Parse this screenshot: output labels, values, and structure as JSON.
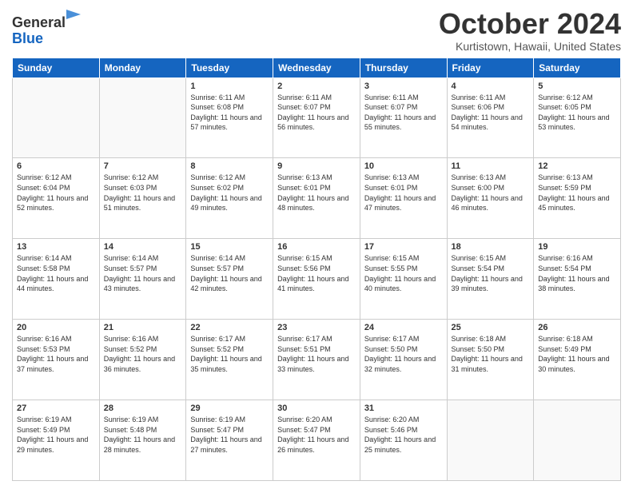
{
  "header": {
    "logo_general": "General",
    "logo_blue": "Blue",
    "month_title": "October 2024",
    "location": "Kurtistown, Hawaii, United States"
  },
  "days_of_week": [
    "Sunday",
    "Monday",
    "Tuesday",
    "Wednesday",
    "Thursday",
    "Friday",
    "Saturday"
  ],
  "weeks": [
    [
      {
        "day": "",
        "sunrise": "",
        "sunset": "",
        "daylight": ""
      },
      {
        "day": "",
        "sunrise": "",
        "sunset": "",
        "daylight": ""
      },
      {
        "day": "1",
        "sunrise": "Sunrise: 6:11 AM",
        "sunset": "Sunset: 6:08 PM",
        "daylight": "Daylight: 11 hours and 57 minutes."
      },
      {
        "day": "2",
        "sunrise": "Sunrise: 6:11 AM",
        "sunset": "Sunset: 6:07 PM",
        "daylight": "Daylight: 11 hours and 56 minutes."
      },
      {
        "day": "3",
        "sunrise": "Sunrise: 6:11 AM",
        "sunset": "Sunset: 6:07 PM",
        "daylight": "Daylight: 11 hours and 55 minutes."
      },
      {
        "day": "4",
        "sunrise": "Sunrise: 6:11 AM",
        "sunset": "Sunset: 6:06 PM",
        "daylight": "Daylight: 11 hours and 54 minutes."
      },
      {
        "day": "5",
        "sunrise": "Sunrise: 6:12 AM",
        "sunset": "Sunset: 6:05 PM",
        "daylight": "Daylight: 11 hours and 53 minutes."
      }
    ],
    [
      {
        "day": "6",
        "sunrise": "Sunrise: 6:12 AM",
        "sunset": "Sunset: 6:04 PM",
        "daylight": "Daylight: 11 hours and 52 minutes."
      },
      {
        "day": "7",
        "sunrise": "Sunrise: 6:12 AM",
        "sunset": "Sunset: 6:03 PM",
        "daylight": "Daylight: 11 hours and 51 minutes."
      },
      {
        "day": "8",
        "sunrise": "Sunrise: 6:12 AM",
        "sunset": "Sunset: 6:02 PM",
        "daylight": "Daylight: 11 hours and 49 minutes."
      },
      {
        "day": "9",
        "sunrise": "Sunrise: 6:13 AM",
        "sunset": "Sunset: 6:01 PM",
        "daylight": "Daylight: 11 hours and 48 minutes."
      },
      {
        "day": "10",
        "sunrise": "Sunrise: 6:13 AM",
        "sunset": "Sunset: 6:01 PM",
        "daylight": "Daylight: 11 hours and 47 minutes."
      },
      {
        "day": "11",
        "sunrise": "Sunrise: 6:13 AM",
        "sunset": "Sunset: 6:00 PM",
        "daylight": "Daylight: 11 hours and 46 minutes."
      },
      {
        "day": "12",
        "sunrise": "Sunrise: 6:13 AM",
        "sunset": "Sunset: 5:59 PM",
        "daylight": "Daylight: 11 hours and 45 minutes."
      }
    ],
    [
      {
        "day": "13",
        "sunrise": "Sunrise: 6:14 AM",
        "sunset": "Sunset: 5:58 PM",
        "daylight": "Daylight: 11 hours and 44 minutes."
      },
      {
        "day": "14",
        "sunrise": "Sunrise: 6:14 AM",
        "sunset": "Sunset: 5:57 PM",
        "daylight": "Daylight: 11 hours and 43 minutes."
      },
      {
        "day": "15",
        "sunrise": "Sunrise: 6:14 AM",
        "sunset": "Sunset: 5:57 PM",
        "daylight": "Daylight: 11 hours and 42 minutes."
      },
      {
        "day": "16",
        "sunrise": "Sunrise: 6:15 AM",
        "sunset": "Sunset: 5:56 PM",
        "daylight": "Daylight: 11 hours and 41 minutes."
      },
      {
        "day": "17",
        "sunrise": "Sunrise: 6:15 AM",
        "sunset": "Sunset: 5:55 PM",
        "daylight": "Daylight: 11 hours and 40 minutes."
      },
      {
        "day": "18",
        "sunrise": "Sunrise: 6:15 AM",
        "sunset": "Sunset: 5:54 PM",
        "daylight": "Daylight: 11 hours and 39 minutes."
      },
      {
        "day": "19",
        "sunrise": "Sunrise: 6:16 AM",
        "sunset": "Sunset: 5:54 PM",
        "daylight": "Daylight: 11 hours and 38 minutes."
      }
    ],
    [
      {
        "day": "20",
        "sunrise": "Sunrise: 6:16 AM",
        "sunset": "Sunset: 5:53 PM",
        "daylight": "Daylight: 11 hours and 37 minutes."
      },
      {
        "day": "21",
        "sunrise": "Sunrise: 6:16 AM",
        "sunset": "Sunset: 5:52 PM",
        "daylight": "Daylight: 11 hours and 36 minutes."
      },
      {
        "day": "22",
        "sunrise": "Sunrise: 6:17 AM",
        "sunset": "Sunset: 5:52 PM",
        "daylight": "Daylight: 11 hours and 35 minutes."
      },
      {
        "day": "23",
        "sunrise": "Sunrise: 6:17 AM",
        "sunset": "Sunset: 5:51 PM",
        "daylight": "Daylight: 11 hours and 33 minutes."
      },
      {
        "day": "24",
        "sunrise": "Sunrise: 6:17 AM",
        "sunset": "Sunset: 5:50 PM",
        "daylight": "Daylight: 11 hours and 32 minutes."
      },
      {
        "day": "25",
        "sunrise": "Sunrise: 6:18 AM",
        "sunset": "Sunset: 5:50 PM",
        "daylight": "Daylight: 11 hours and 31 minutes."
      },
      {
        "day": "26",
        "sunrise": "Sunrise: 6:18 AM",
        "sunset": "Sunset: 5:49 PM",
        "daylight": "Daylight: 11 hours and 30 minutes."
      }
    ],
    [
      {
        "day": "27",
        "sunrise": "Sunrise: 6:19 AM",
        "sunset": "Sunset: 5:49 PM",
        "daylight": "Daylight: 11 hours and 29 minutes."
      },
      {
        "day": "28",
        "sunrise": "Sunrise: 6:19 AM",
        "sunset": "Sunset: 5:48 PM",
        "daylight": "Daylight: 11 hours and 28 minutes."
      },
      {
        "day": "29",
        "sunrise": "Sunrise: 6:19 AM",
        "sunset": "Sunset: 5:47 PM",
        "daylight": "Daylight: 11 hours and 27 minutes."
      },
      {
        "day": "30",
        "sunrise": "Sunrise: 6:20 AM",
        "sunset": "Sunset: 5:47 PM",
        "daylight": "Daylight: 11 hours and 26 minutes."
      },
      {
        "day": "31",
        "sunrise": "Sunrise: 6:20 AM",
        "sunset": "Sunset: 5:46 PM",
        "daylight": "Daylight: 11 hours and 25 minutes."
      },
      {
        "day": "",
        "sunrise": "",
        "sunset": "",
        "daylight": ""
      },
      {
        "day": "",
        "sunrise": "",
        "sunset": "",
        "daylight": ""
      }
    ]
  ]
}
